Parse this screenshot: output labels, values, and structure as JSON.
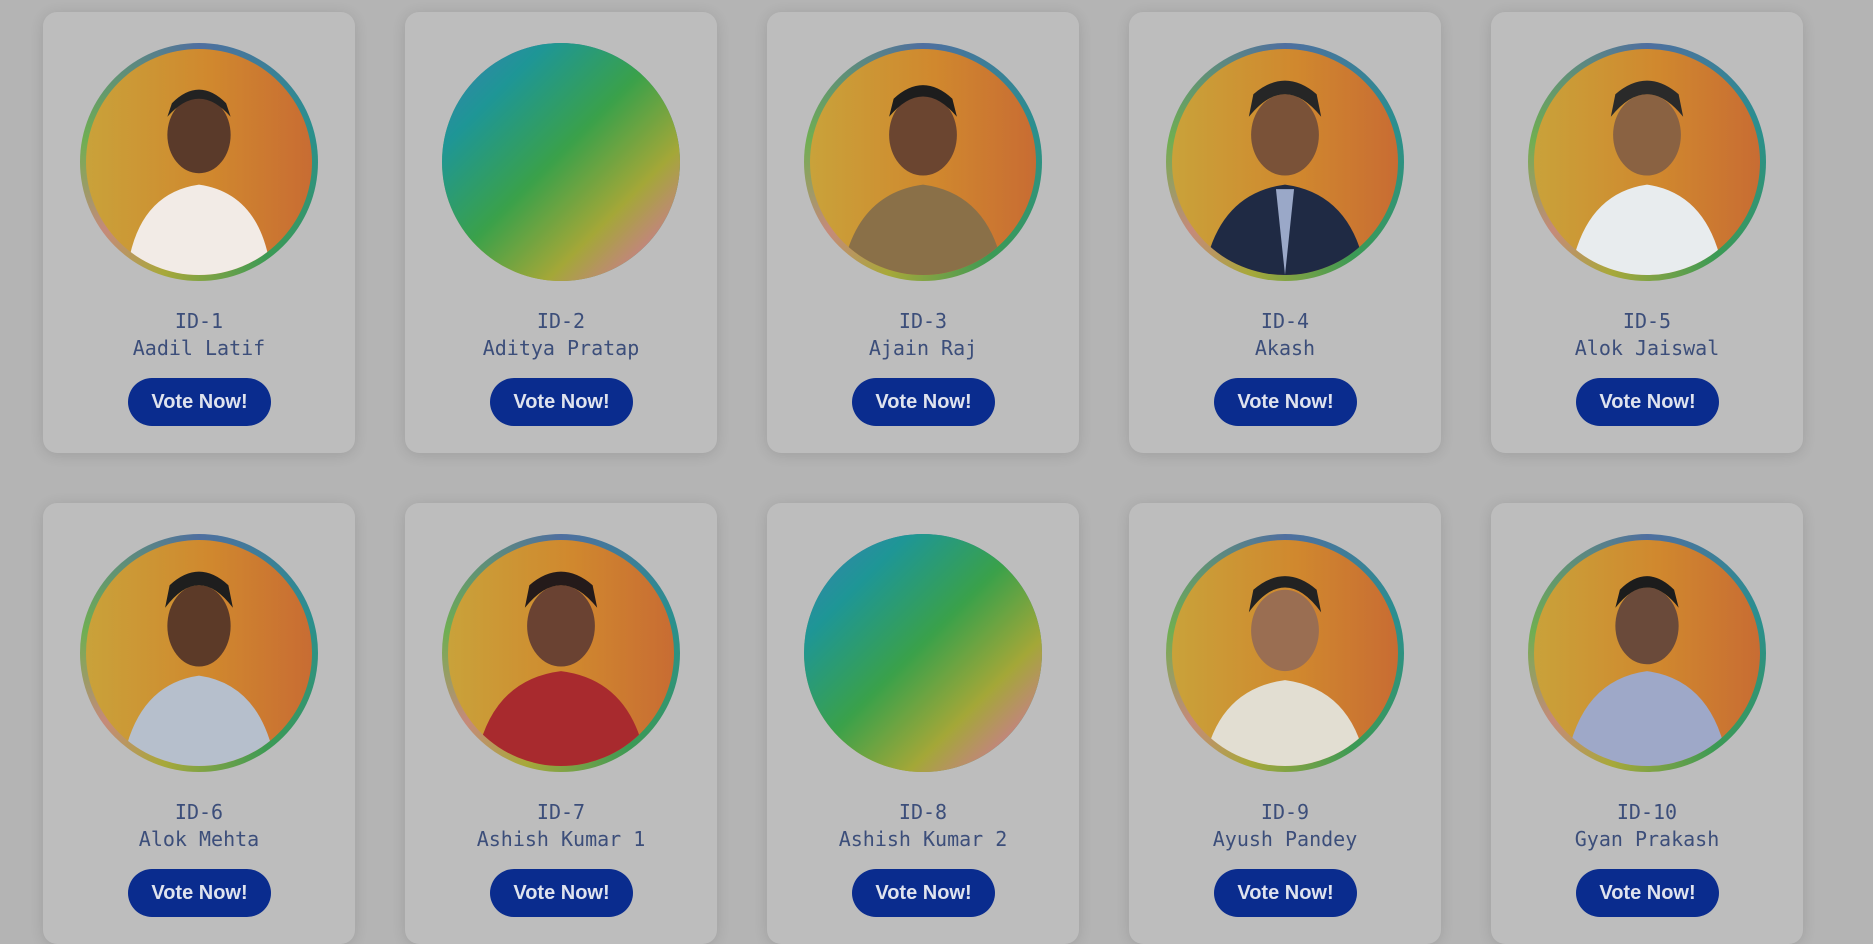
{
  "colors": {
    "page_background": "#b4b4b4",
    "card_background": "#bdbdbd",
    "text": "#3c4e7a",
    "button_background": "#0a2c8e",
    "button_text": "#dfe3ee"
  },
  "candidates": [
    {
      "id": "ID-1",
      "name": "Aadil Latif",
      "button": "Vote Now!",
      "photo": "candidate-photo"
    },
    {
      "id": "ID-2",
      "name": "Aditya Pratap",
      "button": "Vote Now!",
      "photo": "placeholder-gradient"
    },
    {
      "id": "ID-3",
      "name": "Ajain Raj",
      "button": "Vote Now!",
      "photo": "candidate-photo"
    },
    {
      "id": "ID-4",
      "name": "Akash",
      "button": "Vote Now!",
      "photo": "candidate-photo"
    },
    {
      "id": "ID-5",
      "name": "Alok Jaiswal",
      "button": "Vote Now!",
      "photo": "candidate-photo"
    },
    {
      "id": "ID-6",
      "name": "Alok Mehta",
      "button": "Vote Now!",
      "photo": "candidate-photo"
    },
    {
      "id": "ID-7",
      "name": "Ashish Kumar 1",
      "button": "Vote Now!",
      "photo": "candidate-photo"
    },
    {
      "id": "ID-8",
      "name": "Ashish Kumar 2",
      "button": "Vote Now!",
      "photo": "placeholder-gradient"
    },
    {
      "id": "ID-9",
      "name": "Ayush Pandey",
      "button": "Vote Now!",
      "photo": "candidate-photo"
    },
    {
      "id": "ID-10",
      "name": "Gyan Prakash",
      "button": "Vote Now!",
      "photo": "candidate-photo"
    }
  ]
}
